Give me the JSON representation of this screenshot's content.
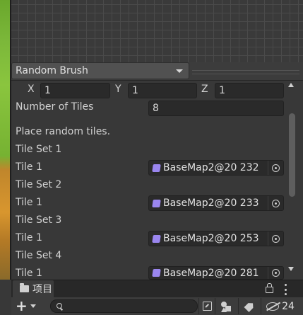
{
  "brush": {
    "selected": "Random Brush"
  },
  "position": {
    "x_label": "X",
    "x_value": "1",
    "y_label": "Y",
    "y_value": "1",
    "z_label": "Z",
    "z_value": "1"
  },
  "number_of_tiles": {
    "label": "Number of Tiles",
    "value": "8"
  },
  "description": "Place random tiles.",
  "tile_sets": [
    {
      "title": "Tile Set 1",
      "tile_label": "Tile 1",
      "tile_value": "BaseMap2@20 232"
    },
    {
      "title": "Tile Set 2",
      "tile_label": "Tile 1",
      "tile_value": "BaseMap2@20 233"
    },
    {
      "title": "Tile Set 3",
      "tile_label": "Tile 1",
      "tile_value": "BaseMap2@20 253"
    },
    {
      "title": "Tile Set 4",
      "tile_label": "Tile 1",
      "tile_value": "BaseMap2@20 281"
    }
  ],
  "project": {
    "tab_label": "项目",
    "create_label": "+",
    "search_placeholder": "",
    "hidden_count": "24"
  },
  "icons": {
    "tile_asset": "tile-asset-icon",
    "picker": "object-picker-icon",
    "folder": "folder-icon",
    "lock": "lock-icon",
    "menu": "kebab-menu-icon",
    "search": "search-icon",
    "open_window": "open-window-icon",
    "type_filter": "type-filter-icon",
    "label_filter": "tag-icon",
    "hidden": "eye-hidden-icon"
  },
  "colors": {
    "background": "#383838",
    "field": "#2a2a2a",
    "tile_asset_icon": "#9a86ef"
  }
}
